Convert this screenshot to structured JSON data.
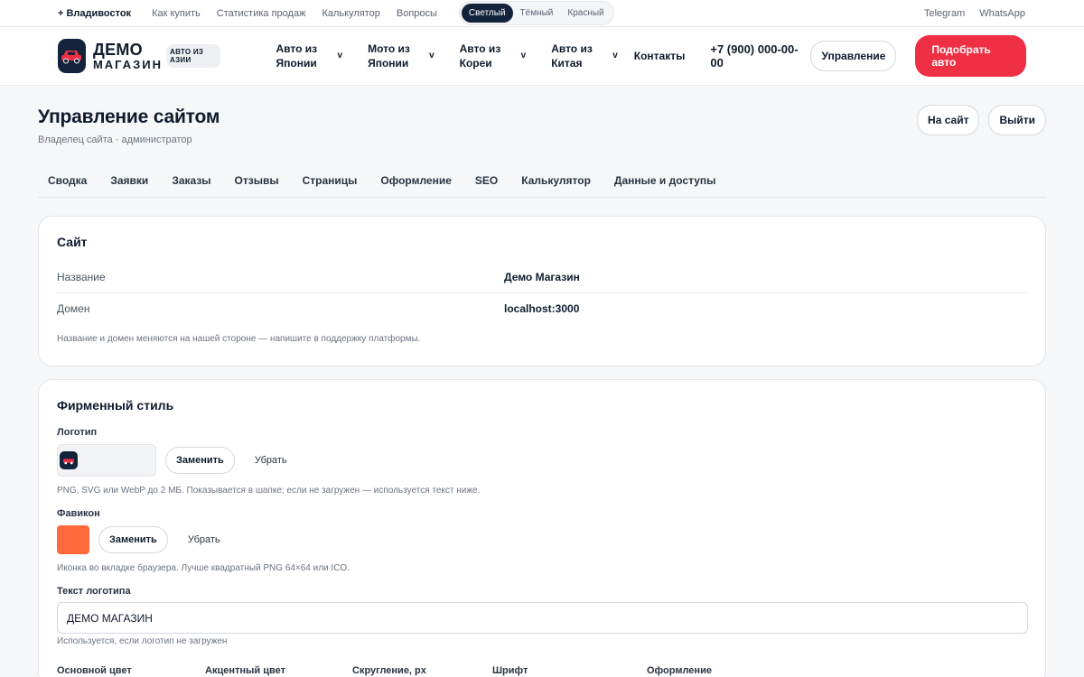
{
  "topbar": {
    "city": "+ Владивосток",
    "links": [
      "Как купить",
      "Статистика продаж",
      "Калькулятор",
      "Вопросы"
    ],
    "themes": [
      "Светлый",
      "Тёмный",
      "Красный"
    ],
    "active_theme": "Светлый",
    "social": [
      "Telegram",
      "WhatsApp"
    ]
  },
  "header": {
    "logo_line1": "ДЕМО",
    "logo_line2": "МАГАЗИН",
    "logo_tag": "АВТО ИЗ АЗИИ",
    "logo_icon": "car-icon",
    "nav": [
      {
        "label": "Авто из Японии"
      },
      {
        "label": "Мото из Японии"
      },
      {
        "label": "Авто из Кореи"
      },
      {
        "label": "Авто из Китая"
      }
    ],
    "contacts": "Контакты",
    "phone": "+7 (900) 000-00-00",
    "manage_btn": "Управление",
    "cta_btn": "Подобрать авто",
    "accent_color": "#ef2f44"
  },
  "page": {
    "title": "Управление сайтом",
    "subtitle": "Владелец сайта · администратор",
    "to_site_btn": "На сайт",
    "logout_btn": "Выйти",
    "tabs": [
      "Сводка",
      "Заявки",
      "Заказы",
      "Отзывы",
      "Страницы",
      "Оформление",
      "SEO",
      "Калькулятор",
      "Данные и доступы"
    ]
  },
  "site_card": {
    "title": "Сайт",
    "rows": [
      {
        "key": "Название",
        "value": "Демо Магазин"
      },
      {
        "key": "Домен",
        "value": "localhost:3000"
      }
    ],
    "note": "Название и домен меняются на нашей стороне — напишите в поддержку платформы."
  },
  "brand_card": {
    "title": "Фирменный стиль",
    "logo_label": "Логотип",
    "logo_replace": "Заменить",
    "logo_remove": "Убрать",
    "logo_note": "PNG, SVG или WebP до 2 МБ. Показывается в шапке; если не загружен — используется текст ниже.",
    "favicon_label": "Фавикон",
    "favicon_color": "#ff6a3d",
    "favicon_replace": "Заменить",
    "favicon_remove": "Убрать",
    "favicon_note": "Иконка во вкладке браузера. Лучше квадратный PNG 64×64 или ICO.",
    "logo_text_label": "Текст логотипа",
    "logo_text_value": "ДЕМО МАГАЗИН",
    "logo_text_note": "Используется, если логотип не загружен",
    "settings_labels": [
      "Основной цвет",
      "Акцентный цвет",
      "Скругление, px",
      "Шрифт",
      "Оформление"
    ]
  }
}
